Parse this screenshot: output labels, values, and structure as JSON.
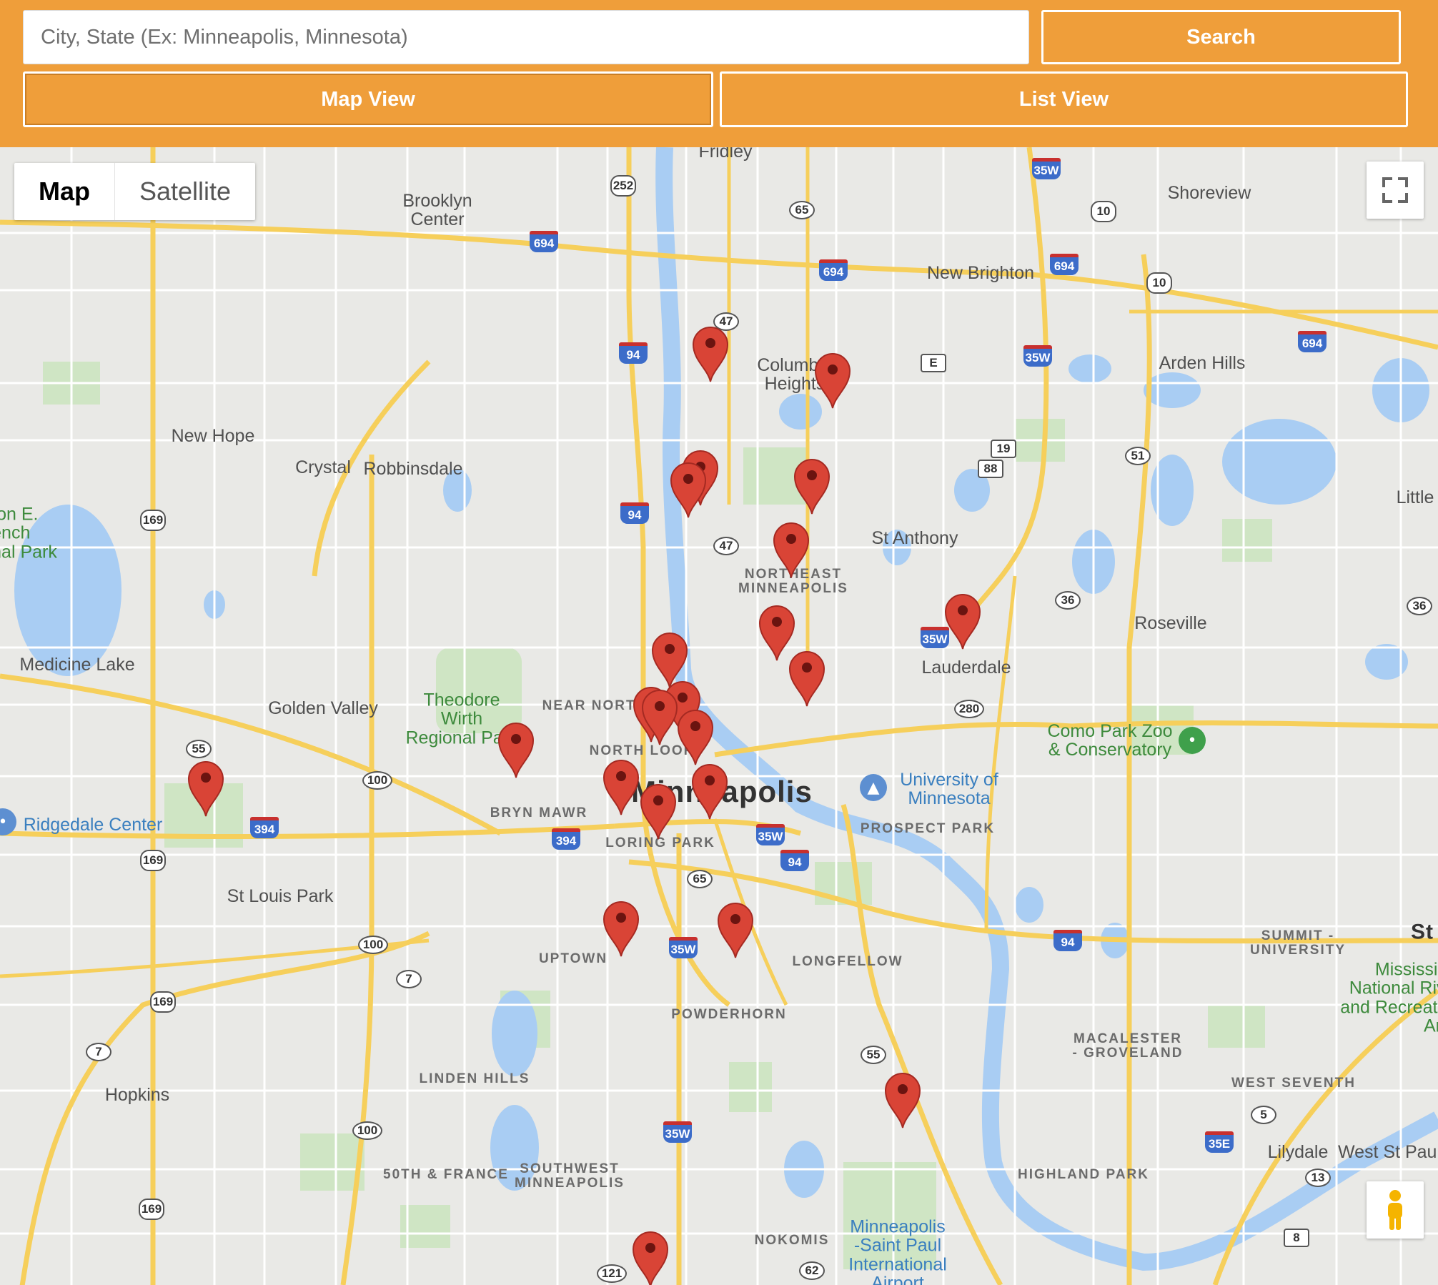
{
  "search": {
    "placeholder": "City, State (Ex: Minneapolis, Minnesota)",
    "search_label": "Search"
  },
  "view_tabs": {
    "map_label": "Map View",
    "list_label": "List View",
    "selected": "Map View"
  },
  "map": {
    "type_control": {
      "map_label": "Map",
      "satellite_label": "Satellite",
      "selected": "Map"
    },
    "controls": {
      "fullscreen_icon": "fullscreen-icon",
      "street_view_icon": "pegman-icon"
    },
    "marker_color": "#d94436",
    "marker_count": 27,
    "labels": {
      "fridley": "Fridley",
      "brooklyn_center": "Brooklyn\nCenter",
      "shoreview": "Shoreview",
      "new_brighton": "New Brighton",
      "arden_hills": "Arden Hills",
      "columbia_heights": "Columbia\nHeights",
      "new_hope": "New Hope",
      "crystal": "Crystal",
      "robbinsdale": "Robbinsdale",
      "st_anthony": "St Anthony",
      "little": "Little",
      "northeast_minneapolis": "NORTHEAST\nMINNEAPOLIS",
      "roseville": "Roseville",
      "lauderdale": "Lauderdale",
      "medicine_lake": "Medicine Lake",
      "golden_valley": "Golden Valley",
      "theodore_wirth": "Theodore\nWirth\nRegional Park",
      "near_north": "NEAR NORTH",
      "north_loop": "NORTH LOOP",
      "minneapolis": "Minneapolis",
      "como_zoo": "Como Park Zoo\n& Conservatory",
      "university": "University of\nMinnesota",
      "prospect_park": "PROSPECT PARK",
      "ridgedale": "Ridgedale Center",
      "bryn_mawr": "BRYN MAWR",
      "loring_park": "LORING PARK",
      "st_louis_park": "St Louis Park",
      "uptown": "UPTOWN",
      "longfellow": "LONGFELLOW",
      "summit_university": "SUMMIT -\nUNIVERSITY",
      "st": "St",
      "mississippi": "Mississippi\nNational River\nand Recreation\nArea",
      "powderhorn": "POWDERHORN",
      "macalester": "MACALESTER\n- GROVELAND",
      "hopkins": "Hopkins",
      "linden_hills": "LINDEN HILLS",
      "west_seventh": "WEST SEVENTH",
      "fiftieth_france": "50TH & FRANCE",
      "southwest_minneapolis": "SOUTHWEST\nMINNEAPOLIS",
      "highland_park": "HIGHLAND PARK",
      "lilydale": "Lilydale",
      "west_st_paul": "West St Paul",
      "nokomis": "NOKOMIS",
      "msp_airport": "Minneapolis\n-Saint Paul\nInternational\nAirport",
      "french_regional_park": "ton E.\nench\nnal Park"
    },
    "shields": {
      "i694_a": "694",
      "i694_b": "694",
      "i694_c": "694",
      "i694_d": "694",
      "i94_a": "94",
      "i94_b": "94",
      "i94_c": "94",
      "i94_d": "94",
      "i35w_a": "35W",
      "i35w_b": "35W",
      "i35w_c": "35W",
      "i35w_d": "35W",
      "i35w_e": "35W",
      "i35w_f": "35W",
      "i394_a": "394",
      "i394_b": "394",
      "i35e": "35E",
      "us252": "252",
      "us10_a": "10",
      "us10_b": "10",
      "us169_a": "169",
      "us169_b": "169",
      "us169_c": "169",
      "us169_d": "169",
      "st65_a": "65",
      "st65_b": "65",
      "st47_a": "47",
      "st47_b": "47",
      "st51": "51",
      "st19": "19",
      "st88": "88",
      "st36_a": "36",
      "st36_b": "36",
      "st280": "280",
      "st55_a": "55",
      "st55_b": "55",
      "st100_a": "100",
      "st100_b": "100",
      "st100_c": "100",
      "st7_a": "7",
      "st7_b": "7",
      "st5": "5",
      "st13": "13",
      "st8": "8",
      "st121": "121",
      "st62": "62",
      "e": "E"
    }
  }
}
